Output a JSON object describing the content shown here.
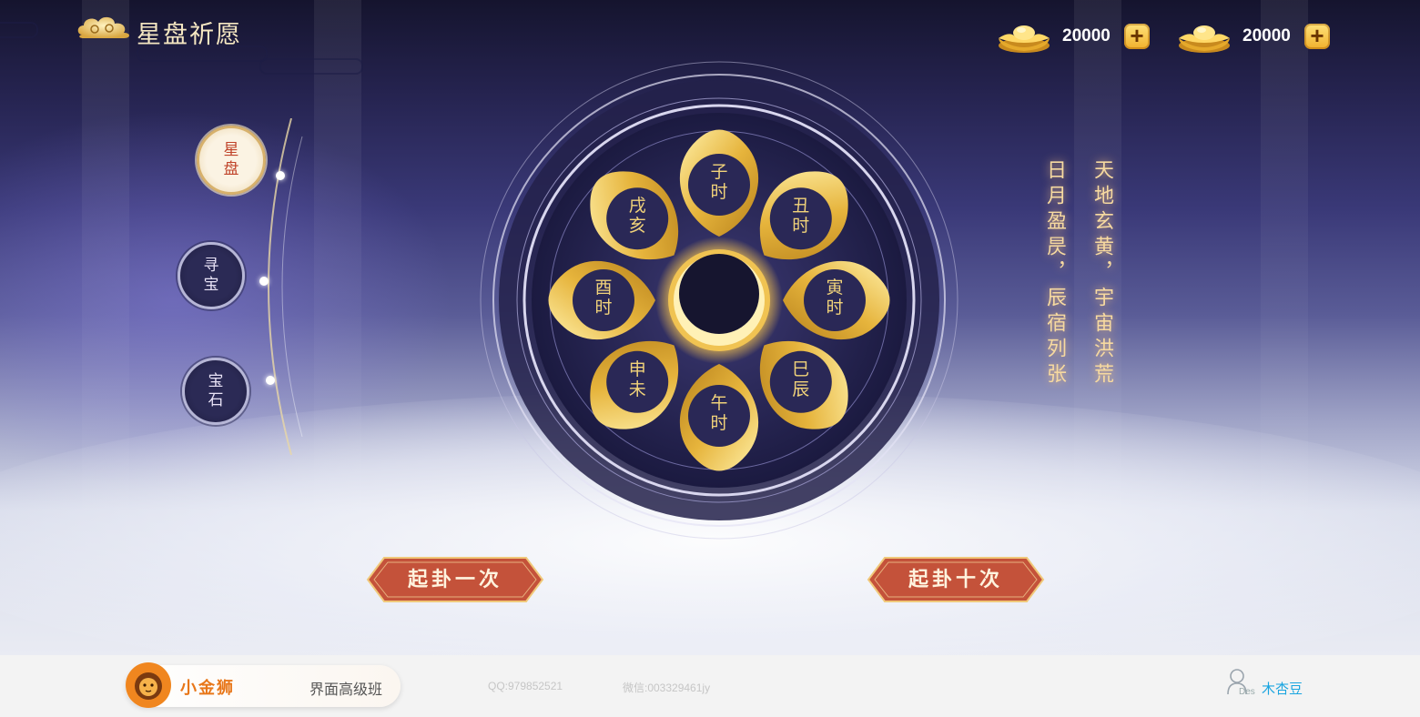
{
  "header": {
    "title": "星盘祈愿"
  },
  "currencies": [
    {
      "icon": "gold-ingot-icon",
      "value": "20000",
      "add_label": "+"
    },
    {
      "icon": "gold-ingot-icon",
      "value": "20000",
      "add_label": "+"
    }
  ],
  "nav": [
    {
      "label": "星盘",
      "active": true
    },
    {
      "label": "寻宝",
      "active": false
    },
    {
      "label": "宝石",
      "active": false
    }
  ],
  "wheel": {
    "petals": [
      "子时",
      "丑时",
      "寅时",
      "巳辰",
      "午时",
      "申未",
      "酉时",
      "戌亥"
    ]
  },
  "verse": {
    "line1": "天地玄黄，宇宙洪荒",
    "line2": "日月盈昃，辰宿列张"
  },
  "actions": {
    "draw_once": "起卦一次",
    "draw_ten": "起卦十次"
  },
  "footer": {
    "brand_name": "小金狮",
    "brand_sub": "界面高级班",
    "qq": "QQ:979852521",
    "wechat": "微信:003329461jy",
    "des_label": "Des",
    "user_name": "木杏豆"
  },
  "colors": {
    "gold": "#f1d37a",
    "button_red": "#c4523a",
    "accent_text": "#f6d9a0"
  }
}
